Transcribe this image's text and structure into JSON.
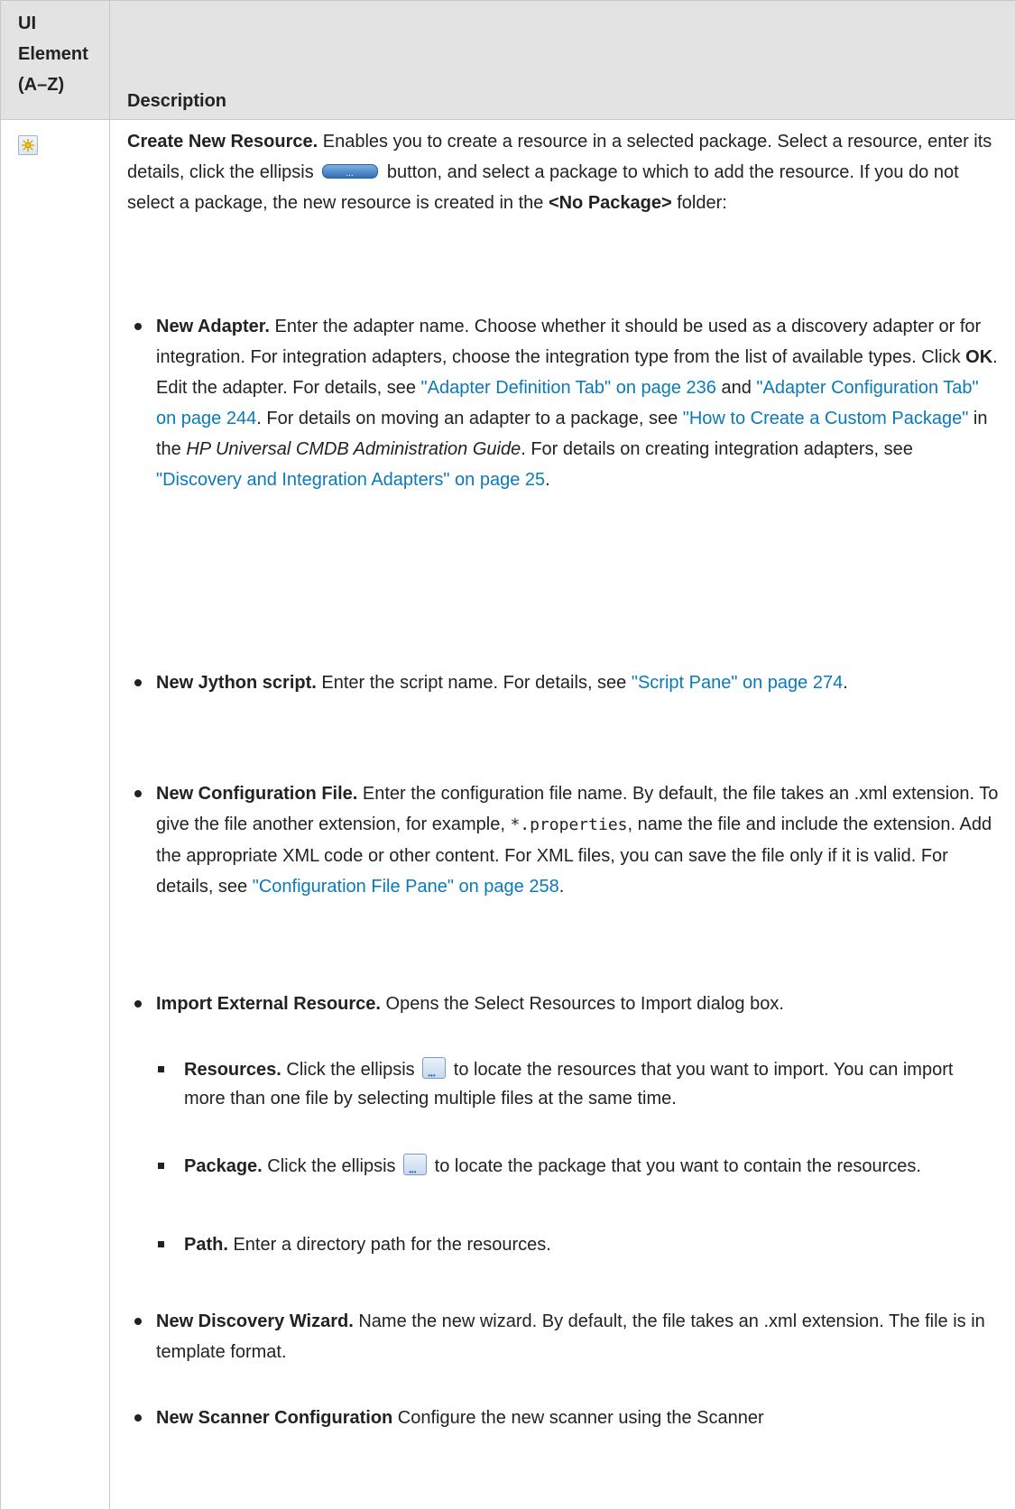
{
  "table": {
    "header": {
      "col1": [
        "UI",
        "Element",
        "(A–Z)"
      ],
      "col2": "Description"
    }
  },
  "row": {
    "icon": "create-new-resource-icon",
    "intro": {
      "title": "Create New Resource.",
      "text1": " Enables you to create a resource in a selected package. Select a resource, enter its details, click the ellipsis ",
      "text2": " button, and select a package to which to add the resource. If you do not select a package, the new resource is created in the ",
      "no_package": "<No Package>",
      "text3": " folder:"
    },
    "items": [
      {
        "title": "New Adapter.",
        "t1": " Enter the adapter name. Choose whether it should be used as a discovery adapter or for integration. For integration adapters, choose the integration type from the list of available types. Click ",
        "ok": "OK",
        "t2": ". Edit the adapter. For details, see ",
        "link1": "\"Adapter Definition Tab\" on page 236",
        "t3": " and ",
        "link2": "\"Adapter Configuration Tab\" on page 244",
        "t4": ". For details on moving an adapter to a package, see ",
        "link3": "\"How to Create a Custom Package\"",
        "t5": " in the ",
        "guide": "HP Universal CMDB Administration Guide",
        "t6": ". For details on creating integration adapters, see ",
        "link4": "\"Discovery and Integration Adapters\" on page 25",
        "t7": "."
      },
      {
        "title": "New Jython script.",
        "t1": " Enter the script name. For details, see ",
        "link1": "\"Script Pane\" on page 274",
        "t2": "."
      },
      {
        "title": "New Configuration File.",
        "t1": " Enter the configuration file name. By default, the file takes an .xml extension. To give the file another extension, for example, ",
        "code": "*.properties",
        "t2": ", name the file and include the extension. Add the appropriate XML code or other content. For XML files, you can save the file only if it is valid. For details, see ",
        "link1": "\"Configuration File Pane\" on page 258",
        "t3": "."
      },
      {
        "title": "Import External Resource.",
        "t1": " Opens the Select Resources to Import dialog box."
      },
      {
        "title": "New Discovery Wizard.",
        "t1": " Name the new wizard. By default, the file takes an .xml extension. The file is in template format."
      },
      {
        "title": "New Scanner Configuration",
        "t1": " Configure the new scanner using the Scanner"
      }
    ],
    "subitems": [
      {
        "title": "Resources.",
        "t1": " Click the ellipsis ",
        "t2": " to locate the resources that you want to import. You can import more than one file by selecting multiple files at the same time."
      },
      {
        "title": "Package.",
        "t1": " Click the ellipsis ",
        "t2": " to locate the package that you want to contain the resources."
      },
      {
        "title": "Path.",
        "t1": " Enter a directory path for the resources."
      }
    ]
  }
}
